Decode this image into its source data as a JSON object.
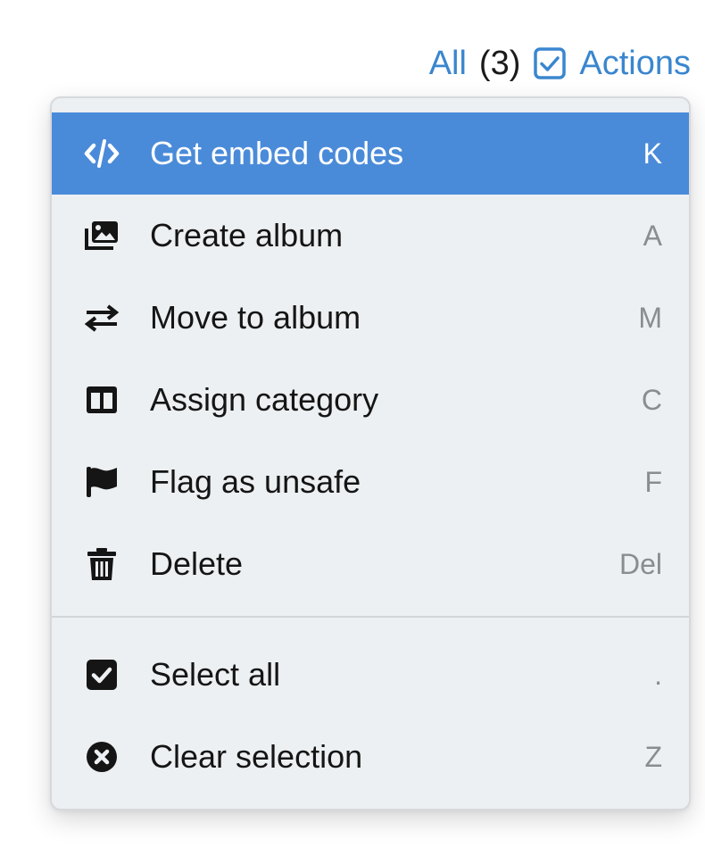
{
  "header": {
    "all_label": "All",
    "count": "(3)",
    "actions_label": "Actions"
  },
  "menu": {
    "items": [
      {
        "label": "Get embed codes",
        "shortcut": "K",
        "icon": "code-icon",
        "active": true
      },
      {
        "label": "Create album",
        "shortcut": "A",
        "icon": "images-icon"
      },
      {
        "label": "Move to album",
        "shortcut": "M",
        "icon": "exchange-arrows-icon"
      },
      {
        "label": "Assign category",
        "shortcut": "C",
        "icon": "columns-icon"
      },
      {
        "label": "Flag as unsafe",
        "shortcut": "F",
        "icon": "flag-icon"
      },
      {
        "label": "Delete",
        "shortcut": "Del",
        "icon": "trash-icon"
      }
    ],
    "selection_items": [
      {
        "label": "Select all",
        "shortcut": ".",
        "icon": "check-square-icon"
      },
      {
        "label": "Clear selection",
        "shortcut": "Z",
        "icon": "times-circle-icon"
      }
    ]
  },
  "colors": {
    "accent": "#3a86cf",
    "highlight": "#4a8bd9",
    "menu_background": "#edf0f2"
  }
}
